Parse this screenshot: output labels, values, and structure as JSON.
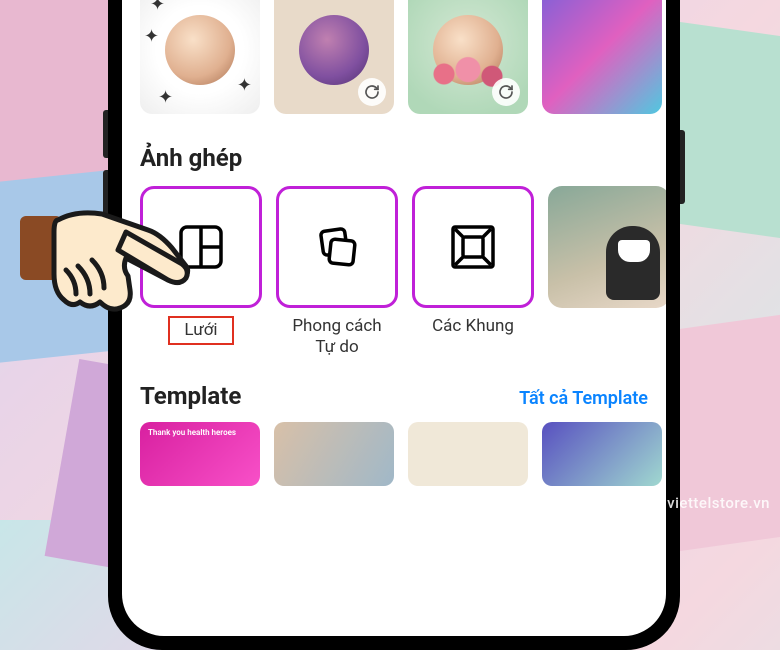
{
  "collage_section": {
    "title": "Ảnh ghép",
    "cards": [
      {
        "label": "Lưới",
        "icon": "grid-icon"
      },
      {
        "label": "Phong cách\nTự do",
        "icon": "freestyle-icon"
      },
      {
        "label": "Các Khung",
        "icon": "frames-icon"
      }
    ]
  },
  "template_section": {
    "title": "Template",
    "all_link": "Tất cả Template",
    "thumb_1_text": "Thank you health heroes"
  },
  "watermark": "viettelstore.vn"
}
